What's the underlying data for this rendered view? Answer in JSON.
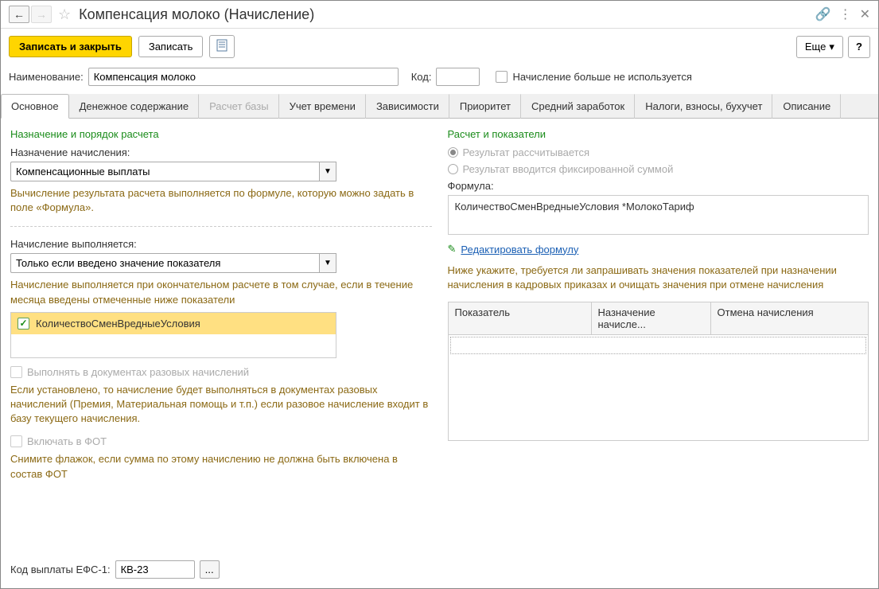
{
  "header": {
    "title": "Компенсация молоко (Начисление)"
  },
  "toolbar": {
    "save_close": "Записать и закрыть",
    "save": "Записать",
    "more": "Еще",
    "help": "?"
  },
  "form": {
    "name_label": "Наименование:",
    "name_value": "Компенсация молоко",
    "code_label": "Код:",
    "code_value": "",
    "not_used_label": "Начисление больше не используется"
  },
  "tabs": [
    "Основное",
    "Денежное содержание",
    "Расчет базы",
    "Учет времени",
    "Зависимости",
    "Приоритет",
    "Средний заработок",
    "Налоги, взносы, бухучет",
    "Описание"
  ],
  "left": {
    "section1_title": "Назначение и порядок расчета",
    "purpose_label": "Назначение начисления:",
    "purpose_value": "Компенсационные выплаты",
    "purpose_hint": "Вычисление результата расчета выполняется по формуле, которую можно задать в поле «Формула».",
    "exec_label": "Начисление выполняется:",
    "exec_value": "Только если введено значение показателя",
    "exec_hint": "Начисление выполняется при окончательном расчете в том случае, если в течение месяца введены отмеченные ниже показатели",
    "indicator_item": "КоличествоСменВредныеУсловия",
    "single_doc_label": "Выполнять в документах разовых начислений",
    "single_doc_hint": "Если установлено, то начисление будет выполняться в документах разовых начислений (Премия, Материальная помощь и т.п.) если разовое начисление входит в базу текущего начисления.",
    "fot_label": "Включать в ФОТ",
    "fot_hint": "Снимите флажок, если сумма по этому начислению не должна быть включена в состав ФОТ"
  },
  "right": {
    "section_title": "Расчет и показатели",
    "radio1": "Результат рассчитывается",
    "radio2": "Результат вводится фиксированной суммой",
    "formula_label": "Формула:",
    "formula_value": "КоличествоСменВредныеУсловия *МолокоТариф",
    "edit_link": "Редактировать формулу",
    "table_hint": "Ниже укажите, требуется ли запрашивать значения показателей при назначении начисления в кадровых приказах и очищать значения при отмене начисления",
    "th1": "Показатель",
    "th2": "Назначение начисле...",
    "th3": "Отмена начисления"
  },
  "footer": {
    "efs_label": "Код выплаты ЕФС-1:",
    "efs_value": "КВ-23"
  }
}
